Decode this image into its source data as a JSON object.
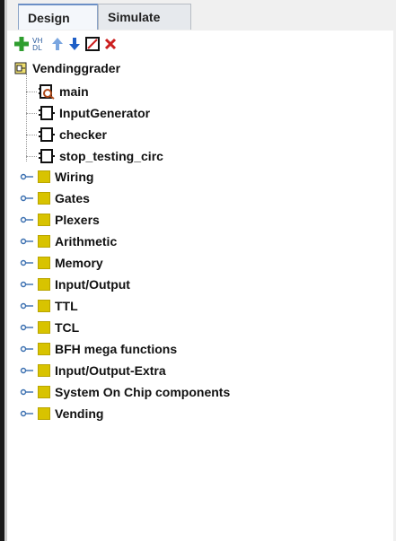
{
  "tabs": [
    {
      "label": "Design",
      "active": true
    },
    {
      "label": "Simulate",
      "active": false
    }
  ],
  "toolbar": {
    "icons": [
      "add-circuit-icon",
      "add-vhdl-icon",
      "move-up-icon",
      "move-down-icon",
      "edit-icon",
      "delete-icon"
    ],
    "vhdl_text": "VH\nDL",
    "colors": {
      "add": "#2f9e2f",
      "arrow_up": "#7aa6e0",
      "arrow_down": "#1f5fc7",
      "delete": "#cc1f1f"
    }
  },
  "project": {
    "name": "Vendinggrader",
    "circuits": [
      {
        "name": "main",
        "icon": "main-circuit-icon"
      },
      {
        "name": "InputGenerator",
        "icon": "circuit-icon"
      },
      {
        "name": "checker",
        "icon": "circuit-icon"
      },
      {
        "name": "stop_testing_circ",
        "icon": "circuit-icon"
      }
    ],
    "libraries": [
      "Wiring",
      "Gates",
      "Plexers",
      "Arithmetic",
      "Memory",
      "Input/Output",
      "TTL",
      "TCL",
      "BFH mega functions",
      "Input/Output-Extra",
      "System On Chip components",
      "Vending"
    ],
    "folder_color": "#d8c300"
  }
}
